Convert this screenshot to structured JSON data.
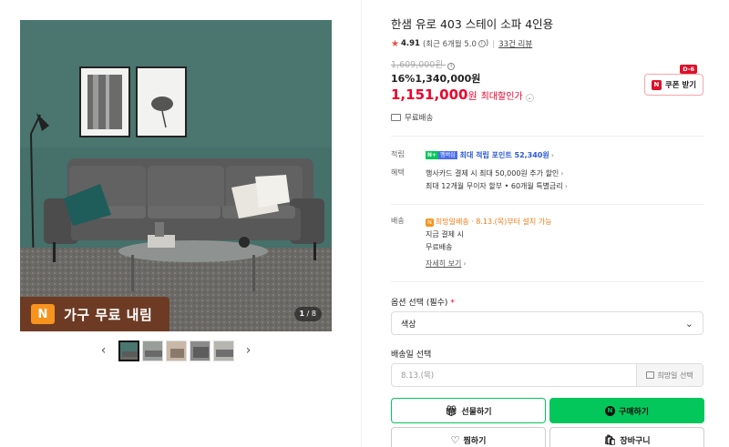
{
  "gallery": {
    "badge_text": "가구 무료 내림",
    "badge_icon": "N",
    "counter_current": "1",
    "counter_total": "/ 8",
    "prev_icon": "chevron-left-icon",
    "next_icon": "chevron-right-icon",
    "thumbnail_count": 5
  },
  "product": {
    "title": "한샘 유로 403 스테이 소파 4인용",
    "rating": "4.91",
    "rating_note": "(최근 6개월 5.0",
    "rating_note_end": ")",
    "review_count": "33건 리뷰",
    "original_price": "1,609,000원",
    "discount_rate": "16%",
    "discount_price": "1,340,000원",
    "final_price": "1,151,000",
    "final_unit": "원",
    "max_discount": "최대할인가",
    "shipping": "무료배송"
  },
  "coupon": {
    "dday": "D-6",
    "label": "쿠폰 받기",
    "logo": "N"
  },
  "details": {
    "points_label": "적립",
    "npay_tag1": "N+",
    "npay_tag2": "멤버십",
    "points_text": "최대 적립 포인트 52,340원",
    "benefits_label": "혜택",
    "benefit_1": "행사카드 결제 시 최대 50,000원 추가 할인",
    "benefit_2": "최대 12개월 무이자 할부 • 60개월 특별금리",
    "delivery_label": "배송",
    "wish_tag": "N",
    "wish_text": "희망일배송 · 8.13.(목)부터 설치 가능",
    "delivery_line2": "지금 결제 시",
    "delivery_line3": "무료배송",
    "more_link": "자세히 보기"
  },
  "options": {
    "option_label": "옵션 선택 (필수)",
    "required_mark": "*",
    "select_value": "색상",
    "date_label": "배송일 선택",
    "date_placeholder": "8.13.(목)",
    "date_pick": "희망일 선택"
  },
  "buttons": {
    "gift": "선물하기",
    "buy": "구매하기",
    "wish": "찜하기",
    "cart": "장바구니"
  },
  "colors": {
    "accent_red": "#f0002b",
    "naver_green": "#03c75a",
    "badge_brown": "#6d3b24",
    "wall_green": "#3f6a62"
  }
}
